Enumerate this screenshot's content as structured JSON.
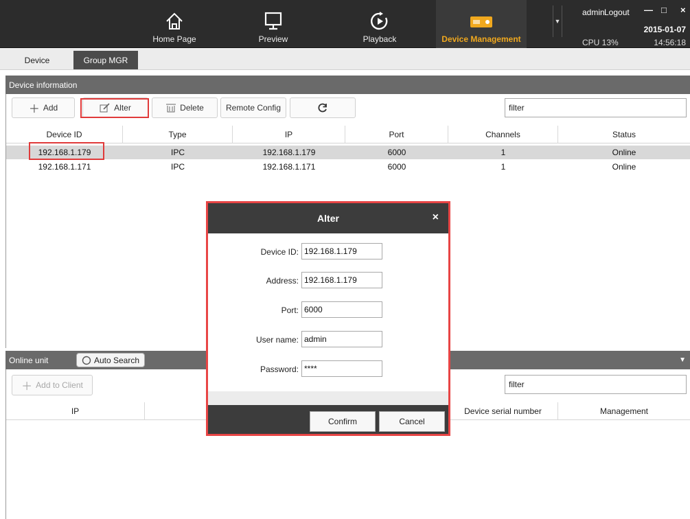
{
  "nav": {
    "items": [
      {
        "label": "Home Page",
        "icon": "home-icon"
      },
      {
        "label": "Preview",
        "icon": "monitor-icon"
      },
      {
        "label": "Playback",
        "icon": "playback-icon"
      },
      {
        "label": "Device Management",
        "icon": "device-management-icon"
      }
    ],
    "active_color": "#f0a81e"
  },
  "window": {
    "user": "admin",
    "logout": "Logout",
    "date": "2015-01-07",
    "cpu": "CPU 13%",
    "time": "14:56:18",
    "minimize": "—",
    "maximize": "□",
    "close": "×"
  },
  "tabs": [
    "Device",
    "Group MGR"
  ],
  "device_info": {
    "title": "Device information",
    "toolbar": {
      "add": "Add",
      "alter": "Alter",
      "delete": "Delete",
      "remote_config": "Remote Config",
      "filter": "filter"
    },
    "columns": [
      "Device ID",
      "Type",
      "IP",
      "Port",
      "Channels",
      "Status"
    ],
    "rows": [
      {
        "id": "192.168.1.179",
        "type": "IPC",
        "ip": "192.168.1.179",
        "port": "6000",
        "channels": "1",
        "status": "Online"
      },
      {
        "id": "192.168.1.171",
        "type": "IPC",
        "ip": "192.168.1.171",
        "port": "6000",
        "channels": "1",
        "status": "Online"
      }
    ]
  },
  "online_unit": {
    "title": "Online unit",
    "auto_search": "Auto Search",
    "add_to_client": "Add to Client",
    "filter": "filter",
    "columns": [
      "IP",
      "Device serial number",
      "Management"
    ]
  },
  "dialog": {
    "title": "Alter",
    "close": "×",
    "fields": [
      {
        "label": "Device ID:",
        "value": "192.168.1.179"
      },
      {
        "label": "Address:",
        "value": "192.168.1.179"
      },
      {
        "label": "Port:",
        "value": "6000"
      },
      {
        "label": "User name:",
        "value": "admin"
      },
      {
        "label": "Password:",
        "value": "****"
      }
    ],
    "confirm": "Confirm",
    "cancel": "Cancel"
  },
  "colors": {
    "highlight": "#e03a3a",
    "topbar": "#2c2c2c",
    "section": "#6a6a6a"
  }
}
